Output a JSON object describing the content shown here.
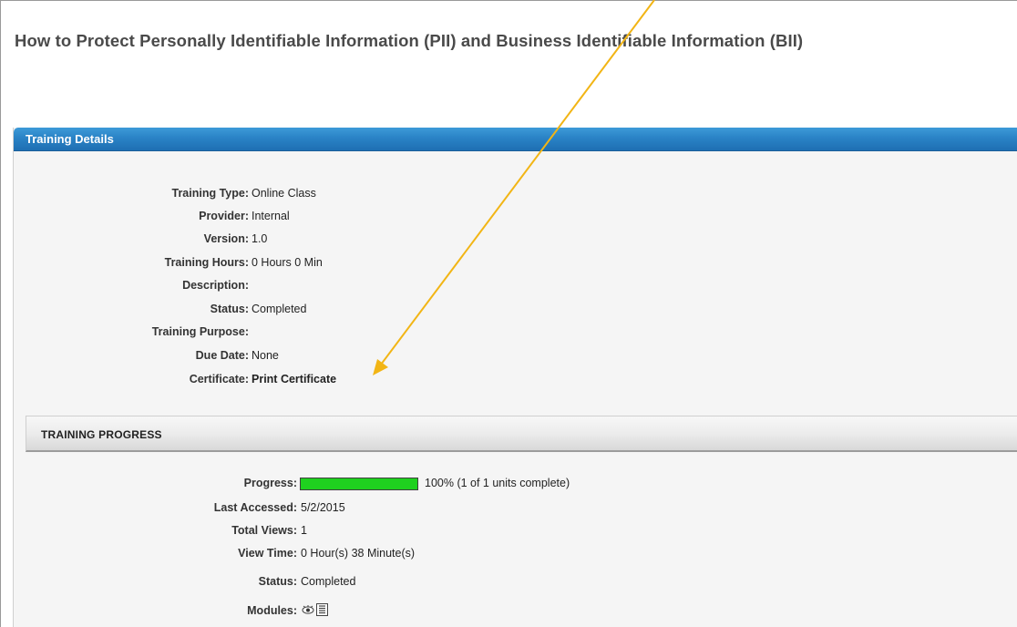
{
  "page_title": "How to Protect Personally Identifiable Information (PII) and Business Identifiable Information (BII)",
  "panel": {
    "title": "Training Details",
    "details": [
      {
        "label": "Training Type:",
        "value": "Online Class"
      },
      {
        "label": "Provider:",
        "value": "Internal"
      },
      {
        "label": "Version:",
        "value": "1.0"
      },
      {
        "label": "Training Hours:",
        "value": "0 Hours 0 Min"
      },
      {
        "label": "Description:",
        "value": ""
      },
      {
        "label": "Status:",
        "value": "Completed"
      },
      {
        "label": "Training Purpose:",
        "value": ""
      },
      {
        "label": "Due Date:",
        "value": "None"
      },
      {
        "label": "Certificate:",
        "value": "Print Certificate"
      }
    ]
  },
  "progress_section": {
    "title": "TRAINING PROGRESS",
    "progress_label": "Progress:",
    "progress_fraction": 1.0,
    "progress_text": "100% (1 of 1 units complete)",
    "last_accessed_label": "Last Accessed:",
    "last_accessed_value": "5/2/2015",
    "total_views_label": "Total Views:",
    "total_views_value": "1",
    "view_time_label": "View Time:",
    "view_time_value": "0 Hour(s) 38 Minute(s)",
    "status_label": "Status:",
    "status_value": "Completed",
    "modules_label": "Modules:",
    "module_icons": [
      "view-icon",
      "list-icon"
    ]
  },
  "colors": {
    "header_blue": "#2a83c6",
    "link_blue": "#1c6aa6",
    "progress_green": "#1fd11f",
    "annotation_arrow": "#f2b515"
  }
}
